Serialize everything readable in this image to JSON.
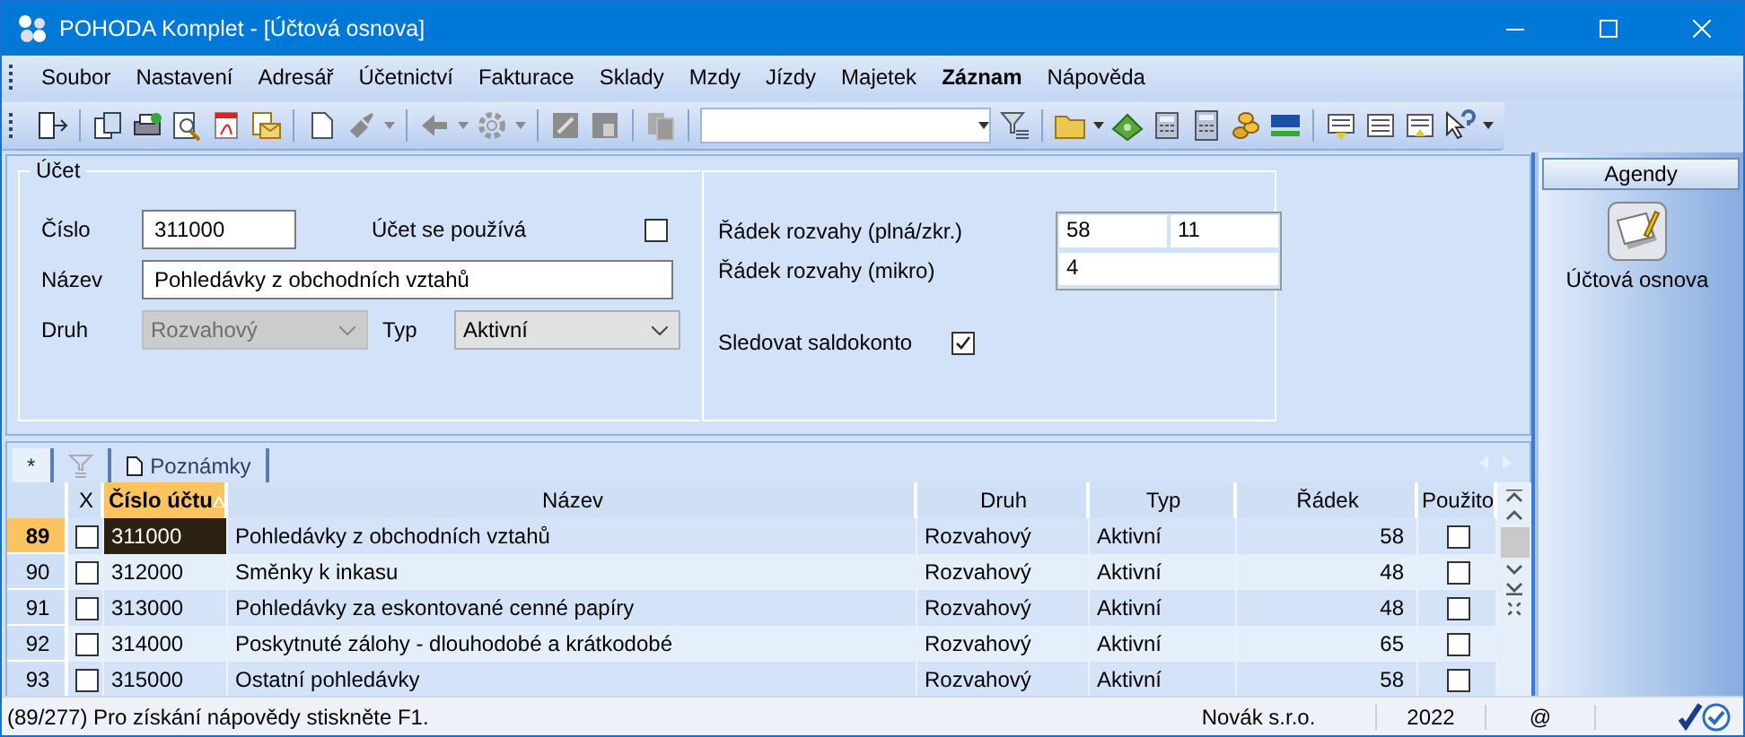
{
  "window": {
    "title": "POHODA Komplet - [Účtová osnova]"
  },
  "menu": [
    {
      "label": "Soubor",
      "bold": false
    },
    {
      "label": "Nastavení",
      "bold": false
    },
    {
      "label": "Adresář",
      "bold": false
    },
    {
      "label": "Účetnictví",
      "bold": false
    },
    {
      "label": "Fakturace",
      "bold": false
    },
    {
      "label": "Sklady",
      "bold": false
    },
    {
      "label": "Mzdy",
      "bold": false
    },
    {
      "label": "Jízdy",
      "bold": false
    },
    {
      "label": "Majetek",
      "bold": false
    },
    {
      "label": "Záznam",
      "bold": true
    },
    {
      "label": "Nápověda",
      "bold": false
    }
  ],
  "form": {
    "group_title": "Účet",
    "number": {
      "label": "Číslo",
      "value": "311000"
    },
    "used": {
      "label": "Účet se používá",
      "checked": false
    },
    "name": {
      "label": "Název",
      "value": "Pohledávky z obchodních vztahů"
    },
    "kind": {
      "label": "Druh",
      "value": "Rozvahový",
      "disabled": true
    },
    "type": {
      "label": "Typ",
      "value": "Aktivní",
      "disabled": false
    },
    "line_full": {
      "label": "Řádek rozvahy (plná/zkr.)",
      "values": [
        "58",
        "11"
      ]
    },
    "line_micro": {
      "label": "Řádek rozvahy (mikro)",
      "value": "4"
    },
    "balance": {
      "label": "Sledovat saldokonto",
      "checked": true
    }
  },
  "tabs": [
    {
      "kind": "new",
      "label": "*",
      "selected": true
    },
    {
      "kind": "filter",
      "selected": false
    },
    {
      "kind": "notes",
      "label": "Poznámky",
      "selected": false
    }
  ],
  "table": {
    "columns": [
      {
        "label": "X",
        "sorted": false
      },
      {
        "label": "Číslo účtu",
        "sorted": true
      },
      {
        "label": "Název",
        "sorted": false
      },
      {
        "label": "Druh",
        "sorted": false
      },
      {
        "label": "Typ",
        "sorted": false
      },
      {
        "label": "Řádek",
        "sorted": false
      },
      {
        "label": "Použito",
        "sorted": false
      }
    ],
    "rows": [
      {
        "number": "89",
        "checked": false,
        "account": "311000",
        "name": "Pohledávky z obchodních vztahů",
        "kind": "Rozvahový",
        "type": "Aktivní",
        "line": "58",
        "used": false,
        "selected": true
      },
      {
        "number": "90",
        "checked": false,
        "account": "312000",
        "name": "Směnky k inkasu",
        "kind": "Rozvahový",
        "type": "Aktivní",
        "line": "48",
        "used": false,
        "selected": false
      },
      {
        "number": "91",
        "checked": false,
        "account": "313000",
        "name": "Pohledávky za eskontované cenné papíry",
        "kind": "Rozvahový",
        "type": "Aktivní",
        "line": "48",
        "used": false,
        "selected": false
      },
      {
        "number": "92",
        "checked": false,
        "account": "314000",
        "name": "Poskytnuté zálohy - dlouhodobé a krátkodobé",
        "kind": "Rozvahový",
        "type": "Aktivní",
        "line": "65",
        "used": false,
        "selected": false
      },
      {
        "number": "93",
        "checked": false,
        "account": "315000",
        "name": "Ostatní pohledávky",
        "kind": "Rozvahový",
        "type": "Aktivní",
        "line": "58",
        "used": false,
        "selected": false
      }
    ]
  },
  "sidebar": {
    "title": "Agendy",
    "items": [
      {
        "label": "Účtová osnova"
      }
    ]
  },
  "status_bar": {
    "message": "(89/277) Pro získání nápovědy stiskněte F1.",
    "company": "Novák s.r.o.",
    "year": "2022",
    "mail": "@"
  }
}
